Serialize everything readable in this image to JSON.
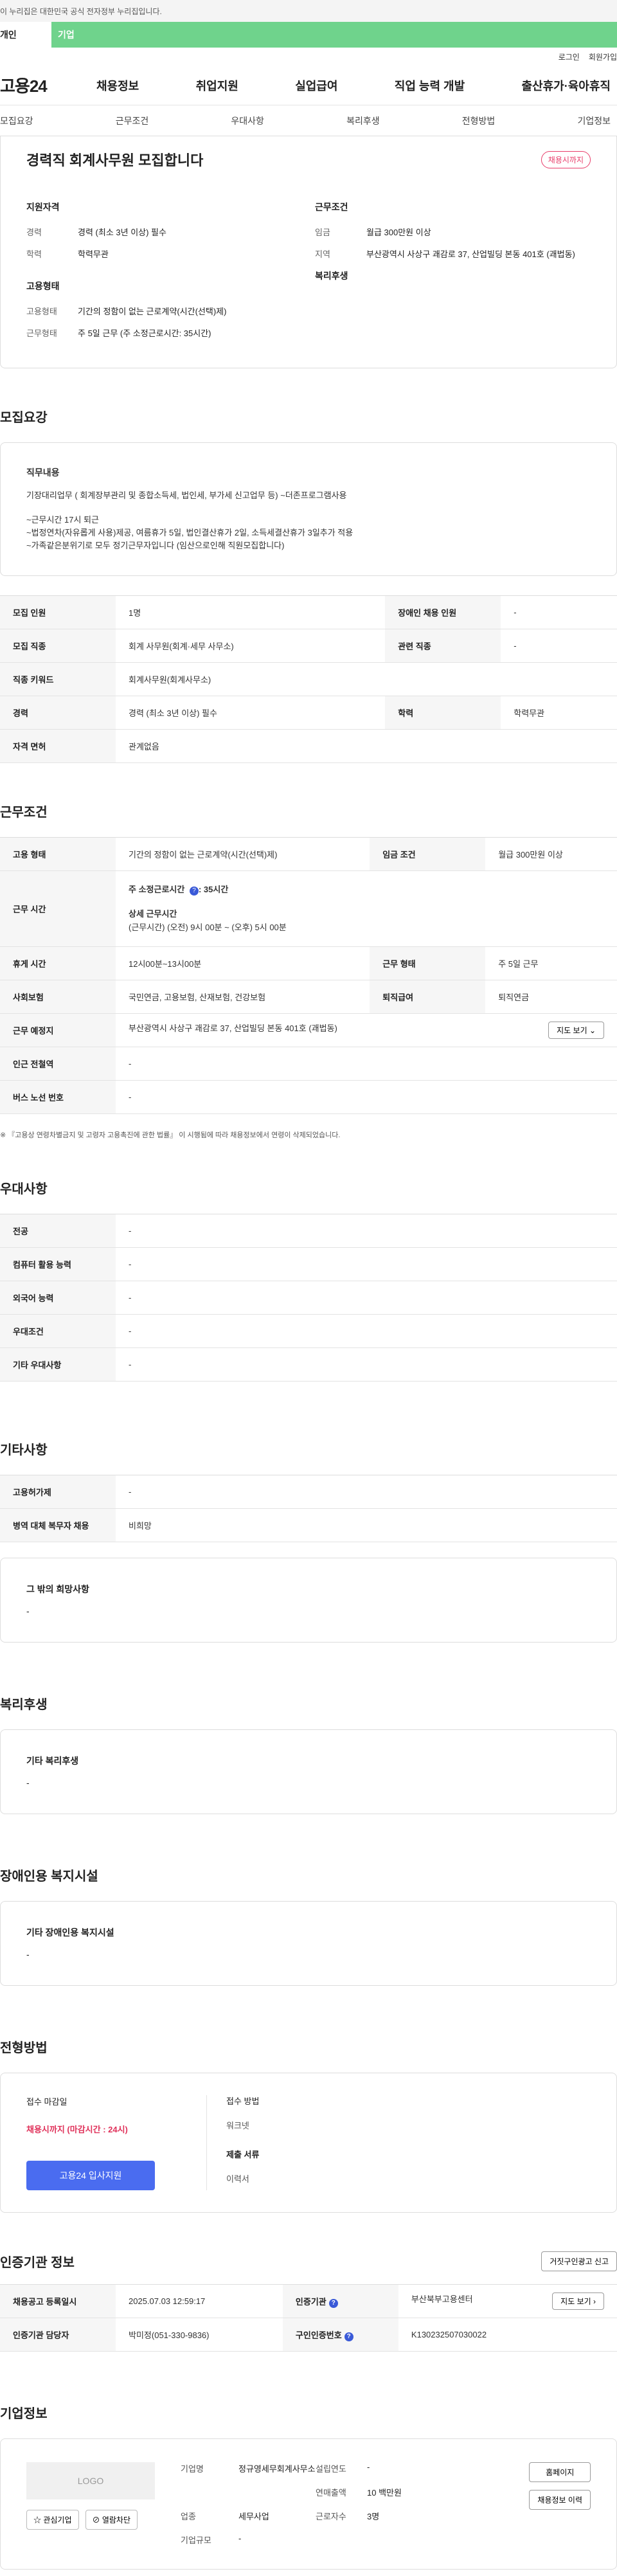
{
  "gov": {
    "notice": "이 누리집은 대한민국 공식 전자정부 누리집입니다."
  },
  "user_tabs": [
    "개인",
    "기업"
  ],
  "util": [
    "로그인",
    "회원가입"
  ],
  "brand": "고용24",
  "gnb": [
    "채용정보",
    "취업지원",
    "실업급여",
    "직업 능력 개발",
    "출산휴가·육아휴직"
  ],
  "anchors": [
    "모집요강",
    "근무조건",
    "우대사항",
    "복리후생",
    "전형방법",
    "기업정보"
  ],
  "summary": {
    "title": "경력직 회계사무원 모집합니다",
    "badge": "채용시까지",
    "qual_title": "지원자격",
    "qual": [
      {
        "k": "경력",
        "v": "경력 (최소 3년 이상) 필수"
      },
      {
        "k": "학력",
        "v": "학력무관"
      }
    ],
    "cond_title": "근무조건",
    "cond": [
      {
        "k": "임금",
        "v": "월급 300만원 이상"
      },
      {
        "k": "지역",
        "v": "부산광역시 사상구 괘감로 37, 산업빌딩 본동 401호 (괘법동)"
      }
    ],
    "type_title": "고용형태",
    "type": [
      {
        "k": "고용형태",
        "v": "기간의 정함이 없는 근로계약(시간(선택)제)"
      },
      {
        "k": "근무형태",
        "v": "주 5일 근무 (주 소정근로시간: 35시간)"
      }
    ],
    "welfare_title": "복리후생"
  },
  "recruit": {
    "title": "모집요강",
    "duty_title": "직무내용",
    "duty_lines": [
      "기장대리업무 ( 회계장부관리 및 종합소득세, 법인세, 부가세 신고업무 등) ~더존프로그램사용",
      "",
      "~근무시간 17시 퇴근",
      "~법정연차(자유롭게 사용)제공, 여름휴가 5일, 법인결산휴가 2일, 소득세결산휴가 3일추가 적용",
      "~가족같은분위기로 모두 정기근무자입니다 (임산으로인해 직원모집합니다)"
    ],
    "rows": [
      [
        {
          "k": "모집 인원",
          "v": "1명"
        },
        {
          "k": "장애인 채용 인원",
          "v": "-"
        }
      ],
      [
        {
          "k": "모집 직종",
          "v": "회계 사무원(회계·세무 사무소)"
        },
        {
          "k": "관련 직종",
          "v": "-"
        }
      ],
      [
        {
          "k": "직종 키워드",
          "v": "회계사무원(회계사무소)"
        }
      ],
      [
        {
          "k": "경력",
          "v": "경력 (최소 3년 이상) 필수"
        },
        {
          "k": "학력",
          "v": "학력무관"
        }
      ],
      [
        {
          "k": "자격 면허",
          "v": "관계없음"
        }
      ]
    ]
  },
  "work": {
    "title": "근무조건",
    "employ_type": {
      "k": "고용 형태",
      "v": "기간의 정함이 없는 근로계약(시간(선택)제)"
    },
    "wage": {
      "k": "임금 조건",
      "v": "월급 300만원 이상"
    },
    "hours_k": "근무 시간",
    "hours_main": "주 소정근로시간",
    "hours_val": ": 35시간",
    "hours_detail_title": "상세 근무시간",
    "hours_detail": "(근무시간) (오전) 9시 00분 ~ (오후) 5시 00분",
    "rest": {
      "k": "휴게 시간",
      "v": "12시00분~13시00분"
    },
    "work_form": {
      "k": "근무 형태",
      "v": "주 5일 근무"
    },
    "insurance": {
      "k": "사회보험",
      "v": "국민연금, 고용보험, 산재보험, 건강보험"
    },
    "severance": {
      "k": "퇴직급여",
      "v": "퇴직연금"
    },
    "place": {
      "k": "근무 예정지",
      "v": "부산광역시 사상구 괘감로 37, 산업빌딩 본동 401호 (괘법동)"
    },
    "map_btn": "지도 보기 ⌄",
    "subway": {
      "k": "인근 전철역",
      "v": "-"
    },
    "bus": {
      "k": "버스 노선 번호",
      "v": "-"
    },
    "note": "※ 『고용상 연령차별금지 및 고령자 고용촉진에 관한 법률』 이 시행됨에 따라 채용정보에서 연령이 삭제되었습니다."
  },
  "pref": {
    "title": "우대사항",
    "rows": [
      {
        "k": "전공",
        "v": "-"
      },
      {
        "k": "컴퓨터 활용 능력",
        "v": "-"
      },
      {
        "k": "외국어 능력",
        "v": "-"
      },
      {
        "k": "우대조건",
        "v": "-"
      },
      {
        "k": "기타 우대사항",
        "v": "-"
      }
    ]
  },
  "etc": {
    "title": "기타사항",
    "rows": [
      {
        "k": "고용허가제",
        "v": "-"
      },
      {
        "k": "병역 대체 복무자 채용",
        "v": "비희망"
      }
    ],
    "hope_title": "그 밖의 희망사항",
    "hope_val": "-"
  },
  "welfare": {
    "title": "복리후생",
    "box_title": "기타 복리후생",
    "val": "-"
  },
  "disabled": {
    "title": "장애인용 복지시설",
    "box_title": "기타 장애인용 복지시설",
    "val": "-"
  },
  "selection": {
    "title": "전형방법",
    "deadline_k": "접수 마감일",
    "deadline_v": "채용시까지 (마감시간 : 24시)",
    "apply_btn": "고용24 입사지원",
    "method_k": "접수 방법",
    "method_v": "워크넷",
    "docs_k": "제출 서류",
    "docs_v": "이력서"
  },
  "cert": {
    "title": "인증기관 정보",
    "report_btn": "거짓구인광고 신고",
    "rows": [
      [
        {
          "k": "채용공고 등록일시",
          "v": "2025.07.03 12:59:17"
        },
        {
          "k": "인증기관",
          "v": "부산북부고용센터"
        }
      ],
      [
        {
          "k": "인증기관 담당자",
          "v": "박미정(051-330-9836)"
        },
        {
          "k": "구인인증번호",
          "v": "K130232507030022"
        }
      ]
    ],
    "map_btn": "지도 보기 ›"
  },
  "company": {
    "title": "기업정보",
    "logo": "LOGO",
    "fav": "☆ 관심기업",
    "block": "⊘ 열람차단",
    "name_k": "기업명",
    "name_v": "정규영세무회계사무소",
    "year_k": "설립연도",
    "year_v": "-",
    "cap_k": "연매출액",
    "cap_v": "10 백만원",
    "ind_k": "업종",
    "ind_v": "세무사업",
    "emp_k": "근로자수",
    "emp_v": "3명",
    "size_k": "기업규모",
    "size_v": "-",
    "home_btn": "홈페이지",
    "hist_btn": "채용정보 이력"
  }
}
